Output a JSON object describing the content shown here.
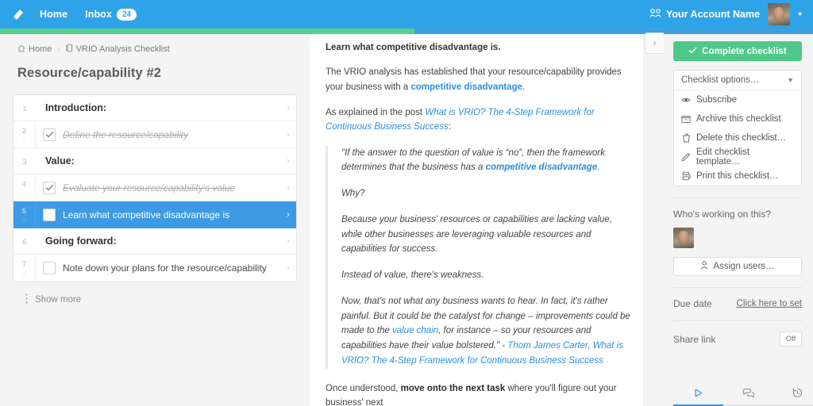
{
  "topnav": {
    "logo": "process-street-logo",
    "home_label": "Home",
    "inbox_label": "Inbox",
    "inbox_count": "24",
    "account_name": "Your Account Name",
    "team_icon": "team-icon",
    "caret_icon": "chevron-down-icon",
    "avatar": "user-avatar"
  },
  "progress": {
    "percent": 51,
    "fill_color": "#5bd08a",
    "track_color": "#3f9ee0"
  },
  "left": {
    "breadcrumb": {
      "home_label": "Home",
      "separator": "›",
      "current_label": "VRIO Analysis Checklist"
    },
    "page_title": "Resource/capability #2",
    "show_more_label": "Show more",
    "rows": [
      {
        "num": "1",
        "type": "section",
        "label": "Introduction:",
        "checked": false,
        "selected": false
      },
      {
        "num": "2",
        "type": "task",
        "label": "Define the resource/capability",
        "checked": true,
        "selected": false
      },
      {
        "num": "3",
        "type": "section",
        "label": "Value:",
        "checked": false,
        "selected": false
      },
      {
        "num": "4",
        "type": "task",
        "label": "Evaluate your resource/capability's value",
        "checked": true,
        "selected": false
      },
      {
        "num": "5",
        "type": "task",
        "label": "Learn what competitive disadvantage is",
        "checked": false,
        "selected": true
      },
      {
        "num": "6",
        "type": "section",
        "label": "Going forward:",
        "checked": false,
        "selected": false
      },
      {
        "num": "7",
        "type": "task",
        "label": "Note down your plans for the resource/capability",
        "checked": false,
        "selected": false
      }
    ]
  },
  "content": {
    "heading": "Learn what competitive disadvantage is.",
    "para1_a": "The VRIO analysis has established that your resource/capability provides your business with a ",
    "para1_link": "competitive disadvantage",
    "para1_b": ".",
    "para2_a": "As explained in the post ",
    "para2_link": "What is VRIO? The 4-Step Framework for Continuous Business Success",
    "para2_b": ":",
    "quote": {
      "q1_a": "\"If the answer to the question of value is “no”, then the framework determines that the business has a ",
      "q1_link": "competitive disadvantage",
      "q1_b": ".",
      "q2": "Why?",
      "q3": "Because your business' resources or capabilities are lacking value, while other businesses are leveraging valuable resources and capabilities for success.",
      "q4": "Instead of value, there's weakness.",
      "q5_a": "Now, that's not what any business wants to hear. In fact, it's rather painful. But it could be the catalyst for change – improvements could be made to the ",
      "q5_link": "value chain",
      "q5_b": ", for instance – so your resources and capabilities have their value bolstered.\" - ",
      "q5_author": "Thom James Carter",
      "q5_comma": ", ",
      "q5_source": "What is VRIO? The 4-Step Framework for Continuous Business Success"
    },
    "tail_a": "Once understood, ",
    "tail_bold": "move onto the next task",
    "tail_b": " where you'll figure out your business' next"
  },
  "collapse": {
    "icon": "chevron-right-icon"
  },
  "right": {
    "complete_button": {
      "label": "Complete checklist",
      "icon": "check-icon",
      "color": "#4ec98a"
    },
    "options_header": {
      "label": "Checklist options…",
      "icon": "chevron-down-icon"
    },
    "options": [
      {
        "label": "Subscribe",
        "icon": "eye-icon"
      },
      {
        "label": "Archive this checklist",
        "icon": "archive-icon"
      },
      {
        "label": "Delete this checklist…",
        "icon": "trash-icon"
      },
      {
        "label": "Edit checklist template…",
        "icon": "pencil-icon"
      },
      {
        "label": "Print this checklist…",
        "icon": "printer-icon"
      }
    ],
    "working_title": "Who's working on this?",
    "assignee_avatar": "user-avatar",
    "assign_button": {
      "label": "Assign users…",
      "icon": "person-icon"
    },
    "due_date": {
      "label": "Due date",
      "value": "Click here to set"
    },
    "share_link": {
      "label": "Share link",
      "value": "Off"
    },
    "tabs": [
      {
        "name": "run",
        "icon": "play-icon",
        "active": true
      },
      {
        "name": "comments",
        "icon": "comments-icon",
        "active": false
      },
      {
        "name": "activity",
        "icon": "history-icon",
        "active": false
      }
    ]
  }
}
